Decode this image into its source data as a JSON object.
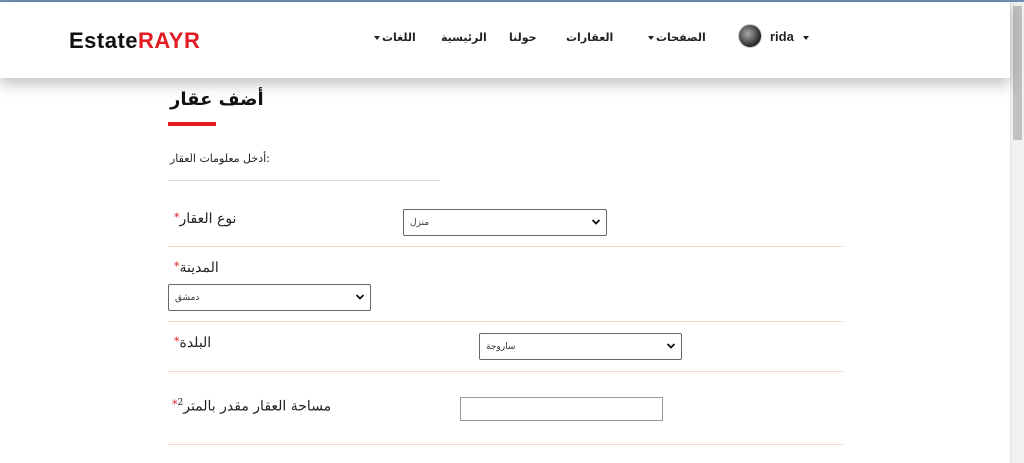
{
  "brand": {
    "part1": "Estate",
    "part2": "RAYR"
  },
  "nav": {
    "languages": "اللغات",
    "home": "الرئيسية",
    "about": "حولنا",
    "properties": "العقارات",
    "pages": "الصفحات",
    "user": "rida"
  },
  "page": {
    "title": "أضف عقار",
    "subtitle": ":أدخل معلومات العقار"
  },
  "form": {
    "property_type": {
      "label": "نوع العقار",
      "required_mark": "*",
      "value": "منزل"
    },
    "city": {
      "label": "المدينة",
      "required_mark": "*",
      "value": "دمشق"
    },
    "town": {
      "label": "البلدة",
      "required_mark": "*",
      "value": "ساروجة"
    },
    "area": {
      "label": "مساحة العقار مقدر بالمتر",
      "superscript": "2",
      "required_mark": "*",
      "value": ""
    }
  },
  "colors": {
    "accent": "#e31b23",
    "divider": "#f1d9cb"
  }
}
